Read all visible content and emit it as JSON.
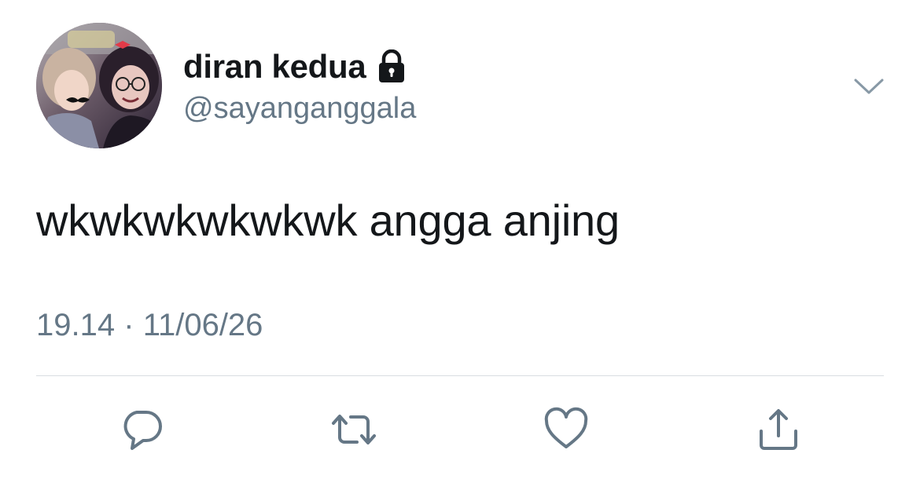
{
  "tweet": {
    "author": {
      "display_name": "diran kedua",
      "handle": "@sayanganggala",
      "protected_icon": "lock-icon",
      "avatar": "profile-photo"
    },
    "text": "wkwkwkwkwkwk angga anjing",
    "time": "19.14",
    "separator": "·",
    "date": "11/06/26",
    "menu_icon": "chevron-down-icon",
    "actions": [
      {
        "name": "reply",
        "icon": "reply-icon"
      },
      {
        "name": "retweet",
        "icon": "retweet-icon"
      },
      {
        "name": "like",
        "icon": "heart-icon"
      },
      {
        "name": "share",
        "icon": "share-icon"
      }
    ]
  },
  "colors": {
    "text": "#14171a",
    "secondary": "#657786",
    "divider": "#d9dde1",
    "icon": "#657786"
  }
}
